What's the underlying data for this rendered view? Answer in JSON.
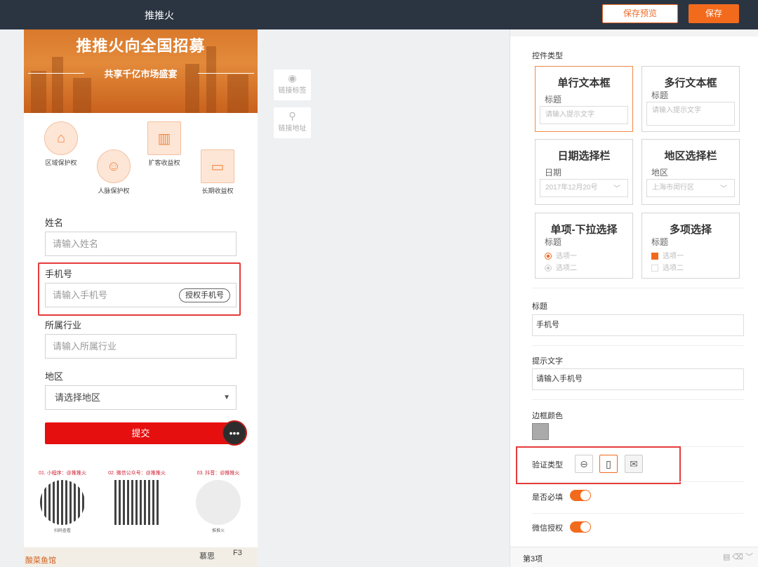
{
  "topbar": {
    "title": "推推火",
    "preview_label": "保存预览",
    "save_label": "保存"
  },
  "phone": {
    "banner_title": "推推火向全国招募",
    "banner_subtitle": "共享千亿市场盛宴",
    "rights": [
      "区域保护权",
      "扩客收益权",
      "人脉保护权",
      "长期收益权"
    ],
    "fields": {
      "name": {
        "label": "姓名",
        "placeholder": "请输入姓名"
      },
      "phone": {
        "label": "手机号",
        "placeholder": "请输入手机号",
        "auth_label": "授权手机号"
      },
      "industry": {
        "label": "所属行业",
        "placeholder": "请输入所属行业"
      },
      "region": {
        "label": "地区",
        "placeholder": "请选择地区"
      }
    },
    "submit_label": "提交",
    "qr": [
      {
        "caption": "01. 小程序：@推推火",
        "sub": "扫码查看"
      },
      {
        "caption": "02. 微信公众号：@推推火",
        "sub": ""
      },
      {
        "caption": "03. 抖音：@推推火",
        "sub": "推推火"
      }
    ],
    "map": {
      "left": "酸菜鱼馆",
      "right": "慕思",
      "floor": "F3"
    }
  },
  "tools": {
    "link_tag": "链接标签",
    "link_address": "链接地址"
  },
  "panel": {
    "control_type_label": "控件类型",
    "control_types": [
      {
        "title": "单行文本框",
        "sub": "标题",
        "input": "请输入提示文字"
      },
      {
        "title": "多行文本框",
        "sub": "标题",
        "input": "请输入提示文字"
      },
      {
        "title": "日期选择栏",
        "sub": "日期",
        "input": "2017年12月20号"
      },
      {
        "title": "地区选择栏",
        "sub": "地区",
        "input": "上海市闵行区"
      },
      {
        "title": "单项-下拉选择",
        "sub": "标题",
        "options": [
          "选项一",
          "选项二"
        ]
      },
      {
        "title": "多项选择",
        "sub": "标题",
        "options": [
          "选项一",
          "选项二"
        ]
      }
    ],
    "title_label": "标题",
    "title_value": "手机号",
    "hint_label": "提示文字",
    "hint_value": "请输入手机号",
    "border_color_label": "边框颜色",
    "verify_label": "验证类型",
    "required_label": "是否必填",
    "wechat_auth_label": "微信授权",
    "section3_label": "第3项",
    "colors": {
      "accent": "#f26a1c",
      "border_swatch": "#aaaaaa"
    }
  }
}
